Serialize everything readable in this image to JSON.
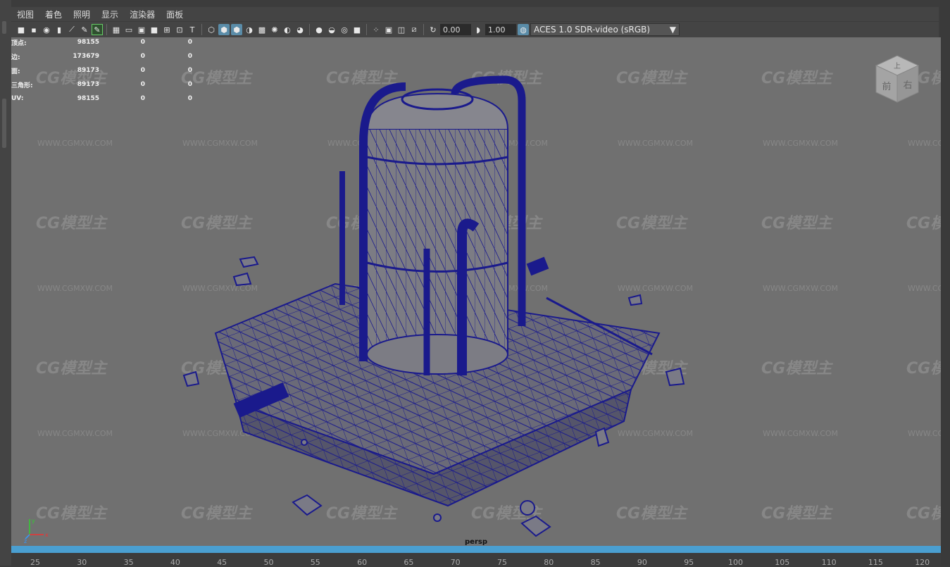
{
  "menubar": {
    "items": [
      "视图",
      "着色",
      "照明",
      "显示",
      "渲染器",
      "面板"
    ]
  },
  "toolbar": {
    "exposure_value": "0.00",
    "gamma_value": "1.00",
    "color_space": "ACES 1.0 SDR-video (sRGB)"
  },
  "hud": {
    "rows": [
      {
        "label": "顶点:",
        "v1": "98155",
        "v2": "0",
        "v3": "0"
      },
      {
        "label": "边:",
        "v1": "173679",
        "v2": "0",
        "v3": "0"
      },
      {
        "label": "面:",
        "v1": "89173",
        "v2": "0",
        "v3": "0"
      },
      {
        "label": "三角形:",
        "v1": "89173",
        "v2": "0",
        "v3": "0"
      },
      {
        "label": "UV:",
        "v1": "98155",
        "v2": "0",
        "v3": "0"
      }
    ]
  },
  "watermark": {
    "logo": "CG模型主",
    "url": "WWW.CGMXW.COM"
  },
  "viewcube": {
    "top_label": "上",
    "front_label": "前",
    "right_label": "右"
  },
  "axis": {
    "x": "x",
    "y": "y",
    "z": "z"
  },
  "camera": {
    "name": "persp"
  },
  "timeline": {
    "ticks": [
      "25",
      "30",
      "35",
      "40",
      "45",
      "50",
      "55",
      "60",
      "65",
      "70",
      "75",
      "80",
      "85",
      "90",
      "95",
      "100",
      "105",
      "110",
      "115",
      "120"
    ]
  },
  "colors": {
    "viewport_bg": "#707070",
    "wireframe": "#1a1a8c",
    "timeline_accent": "#4a9fd1"
  }
}
